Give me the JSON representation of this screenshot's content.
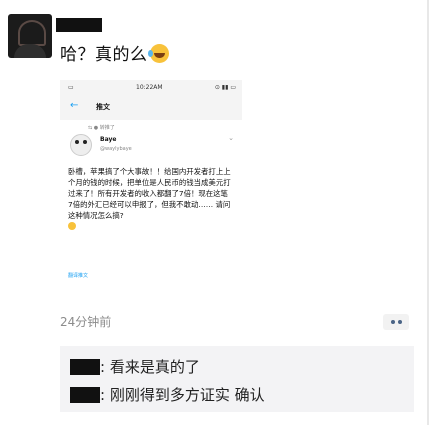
{
  "post": {
    "text": "哈？真的么",
    "emoji": "laughing-tears"
  },
  "screenshot": {
    "status_time": "10:22AM",
    "nav_title": "推文",
    "retweet_label": "转推了",
    "author_name": "Baye",
    "author_handle": "@waylybaye",
    "tweet_text": "卧槽，苹果搞了个大事故！！给国内开发者打上上个月的钱的时候，把单位是人民币的钱当成美元打过来了！所有开发者的收入都翻了7倍！现在这笔7倍的外汇已经可以申报了，但我不敢动…… 请问这种情况怎么搞?",
    "translate_label": "翻译推文"
  },
  "meta": {
    "timestamp": "24分钟前"
  },
  "comments": [
    {
      "sep": ":",
      "text": "看来是真的了"
    },
    {
      "sep": ":",
      "text": "刚刚得到多方证实 确认"
    }
  ]
}
